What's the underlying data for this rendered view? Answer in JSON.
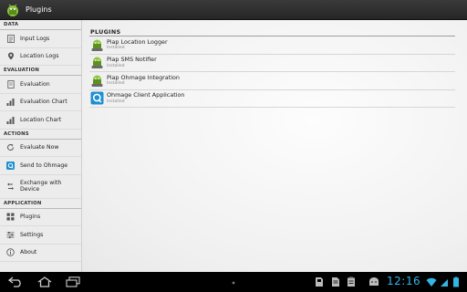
{
  "actionbar": {
    "title": "Plugins"
  },
  "sidebar": {
    "sections": [
      {
        "header": "DATA",
        "items": [
          {
            "label": "Input Logs",
            "icon": "list-icon"
          },
          {
            "label": "Location Logs",
            "icon": "map-pin-icon"
          }
        ]
      },
      {
        "header": "EVALUATION",
        "items": [
          {
            "label": "Evaluation",
            "icon": "document-icon"
          },
          {
            "label": "Evaluation Chart",
            "icon": "bar-chart-icon"
          },
          {
            "label": "Location Chart",
            "icon": "bar-chart-icon"
          }
        ]
      },
      {
        "header": "ACTIONS",
        "items": [
          {
            "label": "Evaluate Now",
            "icon": "refresh-icon"
          },
          {
            "label": "Send to Ohmage",
            "icon": "ohmage-icon"
          },
          {
            "label": "Exchange with Device",
            "icon": "exchange-icon"
          }
        ]
      },
      {
        "header": "APPLICATION",
        "items": [
          {
            "label": "Plugins",
            "icon": "grid-icon"
          },
          {
            "label": "Settings",
            "icon": "sliders-icon"
          },
          {
            "label": "About",
            "icon": "info-icon"
          }
        ]
      }
    ]
  },
  "main": {
    "header": "PLUGINS",
    "plugins": [
      {
        "name": "Piap Location Logger",
        "status": "Installed",
        "icon": "android-plugin-icon"
      },
      {
        "name": "Piap SMS Notifier",
        "status": "Installed",
        "icon": "android-plugin-icon"
      },
      {
        "name": "Piap Ohmage Integration",
        "status": "Installed",
        "icon": "android-plugin-icon"
      },
      {
        "name": "Ohmage Client Application",
        "status": "Installed",
        "icon": "ohmage-app-icon"
      }
    ]
  },
  "systembar": {
    "time": "12:16"
  },
  "colors": {
    "accent": "#33b5e5",
    "android_green": "#8dc63f"
  }
}
